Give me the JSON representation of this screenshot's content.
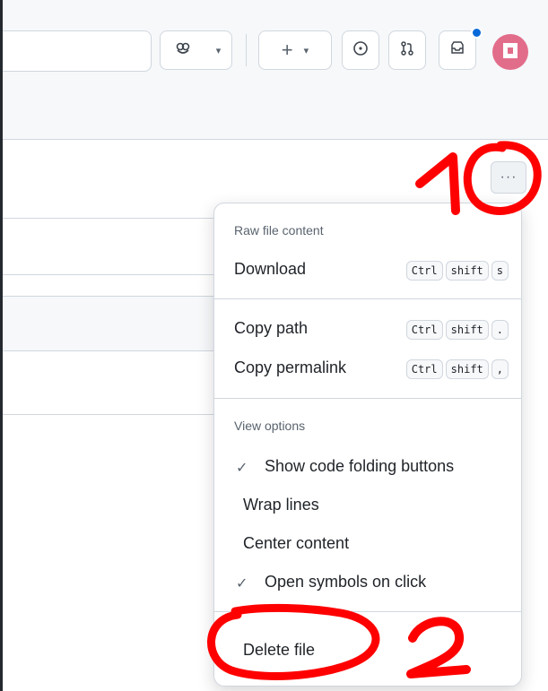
{
  "header": {
    "copilot_icon": "copilot-icon",
    "create_label": "+",
    "issues_icon": "issues-icon",
    "pull_requests_icon": "pull-request-icon",
    "inbox_icon": "inbox-icon"
  },
  "toolbar": {
    "more_label": "···"
  },
  "menu": {
    "section_raw": "Raw file content",
    "download": {
      "label": "Download",
      "keys": [
        "Ctrl",
        "shift",
        "s"
      ]
    },
    "copy_path": {
      "label": "Copy path",
      "keys": [
        "Ctrl",
        "shift",
        "."
      ]
    },
    "copy_permalink": {
      "label": "Copy permalink",
      "keys": [
        "Ctrl",
        "shift",
        ","
      ]
    },
    "section_view": "View options",
    "show_folding": {
      "label": "Show code folding buttons",
      "checked": true
    },
    "wrap_lines": {
      "label": "Wrap lines",
      "checked": false
    },
    "center_content": {
      "label": "Center content",
      "checked": false
    },
    "open_symbols": {
      "label": "Open symbols on click",
      "checked": true
    },
    "delete_file": "Delete file"
  },
  "annotations": {
    "step1": "1",
    "step2": "2",
    "color": "#ff0000"
  }
}
